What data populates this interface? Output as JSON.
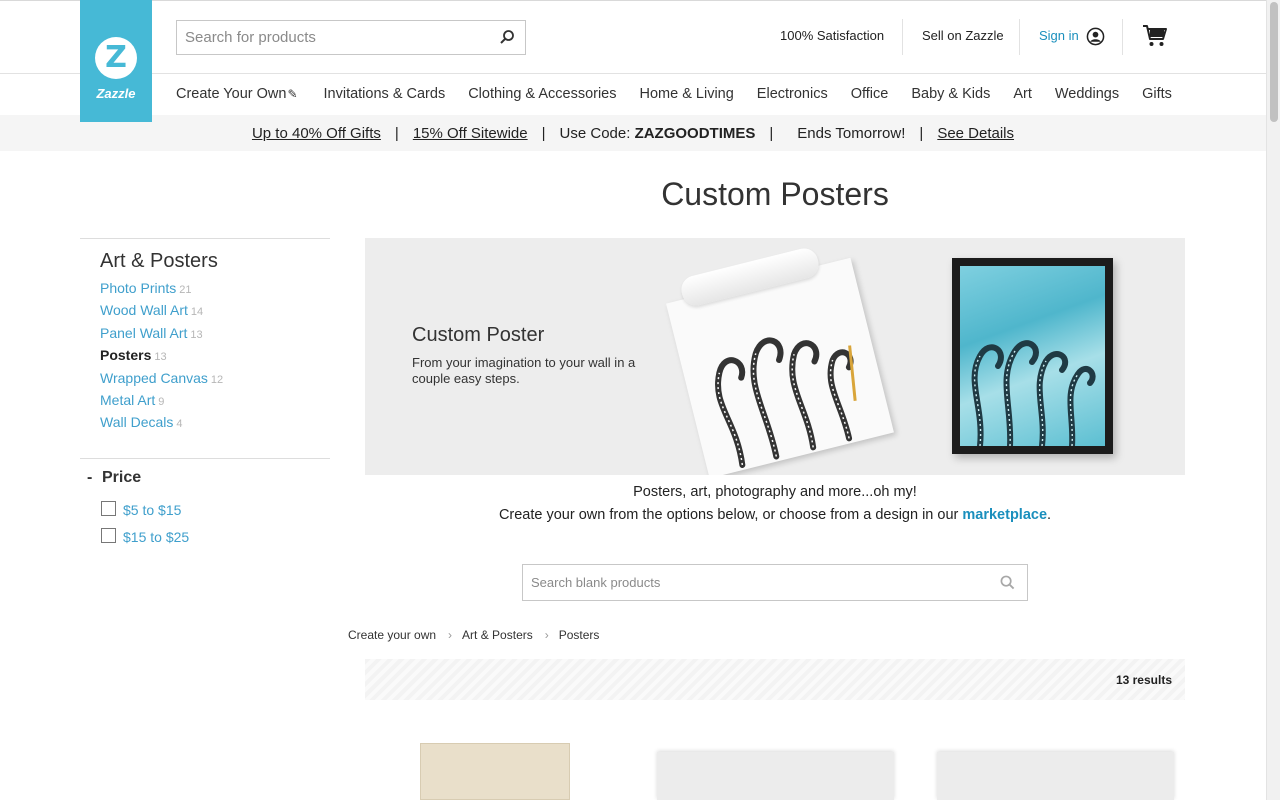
{
  "header": {
    "logo_text": "Zazzle",
    "search_placeholder": "Search for products",
    "satisfaction": "100% Satisfaction",
    "sell": "Sell on Zazzle",
    "signin": "Sign in"
  },
  "nav": {
    "items": [
      "Create Your Own",
      "Invitations & Cards",
      "Clothing & Accessories",
      "Home & Living",
      "Electronics",
      "Office",
      "Baby & Kids",
      "Art",
      "Weddings",
      "Gifts"
    ]
  },
  "promo": {
    "offer1": "Up to 40% Off Gifts",
    "offer2": "15% Off Sitewide",
    "code_label": "Use Code:",
    "code": "ZAZGOODTIMES",
    "ends": "Ends Tomorrow!",
    "details": "See Details",
    "separator": "|"
  },
  "page_title": "Custom Posters",
  "sidebar": {
    "heading": "Art & Posters",
    "items": [
      {
        "label": "Photo Prints",
        "count": "21"
      },
      {
        "label": "Wood Wall Art",
        "count": "14"
      },
      {
        "label": "Panel Wall Art",
        "count": "13"
      },
      {
        "label": "Posters",
        "count": "13"
      },
      {
        "label": "Wrapped Canvas",
        "count": "12"
      },
      {
        "label": "Metal Art",
        "count": "9"
      },
      {
        "label": "Wall Decals",
        "count": "4"
      }
    ],
    "price": {
      "toggle": "-",
      "label": "Price",
      "options": [
        "$5 to $15",
        "$15 to $25"
      ]
    }
  },
  "banner": {
    "title": "Custom Poster",
    "subtitle": "From your imagination to your wall in a couple easy steps."
  },
  "blurb": {
    "line1": "Posters, art, photography and more...oh my!",
    "line2_prefix": "Create your own from the options below, or choose from a design in our",
    "line2_link": "marketplace",
    "line2_suffix": "."
  },
  "blank_search": {
    "placeholder": "Search blank products"
  },
  "breadcrumb": [
    "Create your own",
    "Art & Posters",
    "Posters"
  ],
  "results": "13 results",
  "colors": {
    "brand": "#46b9d6",
    "link": "#1a8fbd"
  }
}
